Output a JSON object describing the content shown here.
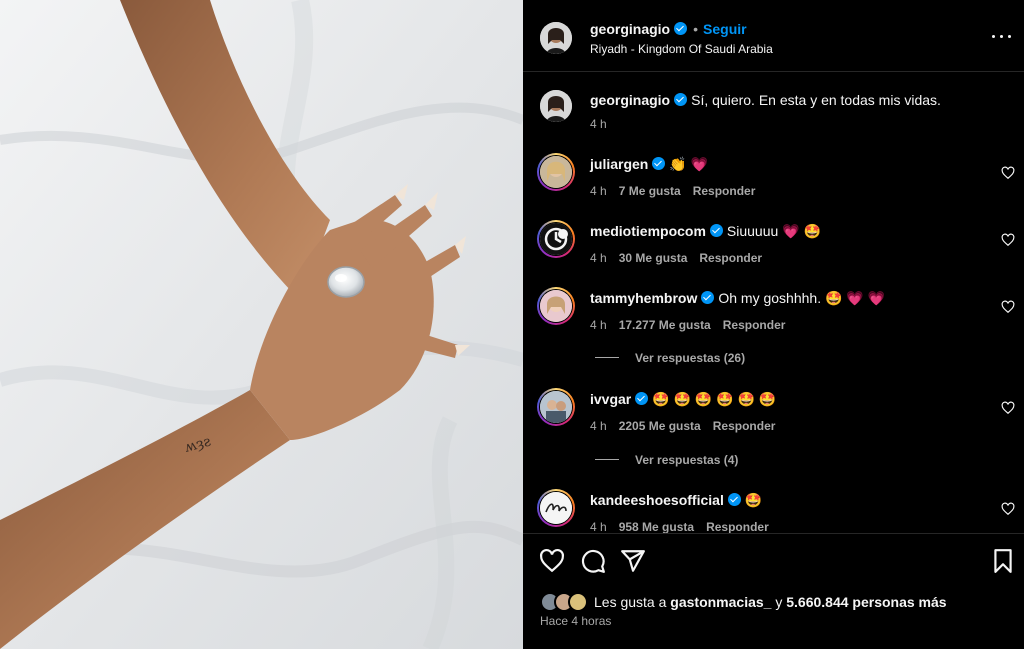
{
  "post": {
    "author": "georginagio",
    "dot": "•",
    "follow_label": "Seguir",
    "location": "Riyadh - Kingdom Of Saudi Arabia",
    "caption": "Sí, quiero. En esta y en todas mis vidas.",
    "caption_time": "4 h"
  },
  "comments": [
    {
      "user": "juliargen",
      "text": "👏 💗",
      "time": "4 h",
      "likes": "7 Me gusta",
      "reply": "Responder"
    },
    {
      "user": "mediotiempocom",
      "text": "Siuuuuu 💗 🤩",
      "time": "4 h",
      "likes": "30 Me gusta",
      "reply": "Responder"
    },
    {
      "user": "tammyhembrow",
      "text": "Oh my goshhhh. 🤩 💗 💗",
      "time": "4 h",
      "likes": "17.277 Me gusta",
      "reply": "Responder",
      "view_replies": "Ver respuestas (26)"
    },
    {
      "user": "ivvgar",
      "text": "🤩 🤩 🤩 🤩 🤩 🤩",
      "time": "4 h",
      "likes": "2205 Me gusta",
      "reply": "Responder",
      "view_replies": "Ver respuestas (4)"
    },
    {
      "user": "kandeeshoesofficial",
      "text": "🤩",
      "time": "4 h",
      "likes": "958 Me gusta",
      "reply": "Responder"
    }
  ],
  "footer": {
    "likes_prefix": "Les gusta a",
    "likes_user": "gastonmacias_",
    "likes_mid": "y",
    "likes_count": "5.660.844 personas más",
    "time_ago": "Hace 4 horas"
  },
  "icons": {
    "like": "heart-icon",
    "comment": "comment-icon",
    "share": "share-icon",
    "save": "bookmark-icon",
    "more": "more-options-icon",
    "verified": "verified-badge-icon"
  },
  "colors": {
    "background": "#000000",
    "text": "#f5f5f5",
    "secondary": "#a8a8a8",
    "accent": "#0095f6"
  }
}
